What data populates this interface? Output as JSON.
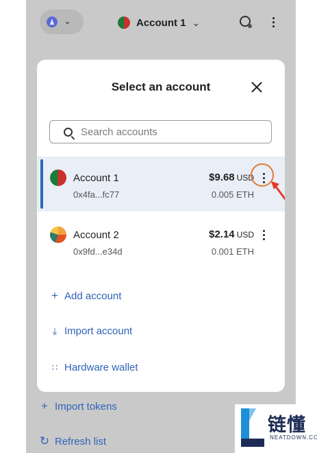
{
  "header": {
    "account_name": "Account 1",
    "network_icon": "ethereum-icon",
    "connection_icon": "globe-icon",
    "menu_icon": "kebab-menu-icon"
  },
  "background_links": [
    {
      "icon": "plus-icon",
      "label": "Import tokens"
    },
    {
      "icon": "refresh-icon",
      "label": "Refresh list"
    }
  ],
  "modal": {
    "title": "Select an account",
    "search_placeholder": "Search accounts",
    "accounts": [
      {
        "name": "Account 1",
        "address": "0x4fa...fc77",
        "balance": "$9.68",
        "currency": "USD",
        "eth": "0.005 ETH",
        "selected": true
      },
      {
        "name": "Account 2",
        "address": "0x9fd...e34d",
        "balance": "$2.14",
        "currency": "USD",
        "eth": "0.001 ETH",
        "selected": false
      }
    ],
    "actions": [
      {
        "icon": "plus-icon",
        "label": "Add account"
      },
      {
        "icon": "import-icon",
        "label": "Import account"
      },
      {
        "icon": "hardware-icon",
        "label": "Hardware wallet"
      }
    ]
  },
  "watermark": {
    "brand_cn": "链懂",
    "brand_en": "NEATDOWN.COM"
  },
  "colors": {
    "accent": "#2f63b8",
    "selected_bg": "#e9eef7",
    "annotation": "#e37b2f"
  }
}
